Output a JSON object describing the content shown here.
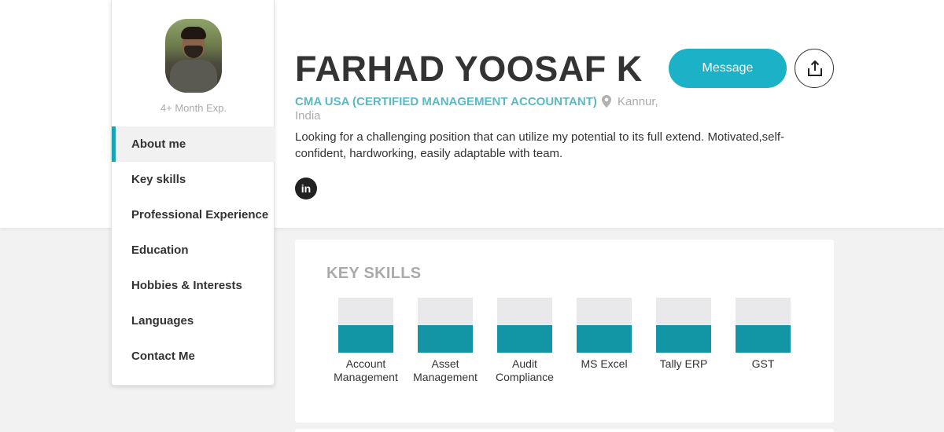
{
  "profile": {
    "name": "FARHAD YOOSAF K",
    "role": "CMA USA (CERTIFIED MANAGEMENT ACCOUNTANT)",
    "location_line1": "Kannur,",
    "location_line2": "India",
    "experience": "4+ Month Exp.",
    "about": "Looking for a challenging position that can utilize my potential to its full extend. Motivated,self-confident, hardworking, easily adaptable with team.",
    "linkedin_label": "in"
  },
  "actions": {
    "message_label": "Message"
  },
  "nav": {
    "items": [
      {
        "label": "About me",
        "active": true
      },
      {
        "label": "Key skills"
      },
      {
        "label": "Professional Experience"
      },
      {
        "label": "Education"
      },
      {
        "label": "Hobbies & Interests"
      },
      {
        "label": "Languages"
      },
      {
        "label": "Contact Me"
      }
    ]
  },
  "skills": {
    "title": "KEY SKILLS",
    "items": [
      {
        "line1": "Account",
        "line2": "Management",
        "level": 0.5
      },
      {
        "line1": "Asset",
        "line2": "Management",
        "level": 0.5
      },
      {
        "line1": "Audit",
        "line2": "Compliance",
        "level": 0.5
      },
      {
        "line1": "MS Excel",
        "line2": "",
        "level": 0.5
      },
      {
        "line1": "Tally ERP",
        "line2": "",
        "level": 0.5
      },
      {
        "line1": "GST",
        "line2": "",
        "level": 0.5
      }
    ]
  },
  "colors": {
    "accent": "#1bb2c7",
    "skill_fill": "#1296a6",
    "role_text": "#5bb8c6"
  },
  "icons": {
    "location": "map-pin-icon",
    "share": "share-upload-icon",
    "linkedin": "linkedin-icon"
  }
}
